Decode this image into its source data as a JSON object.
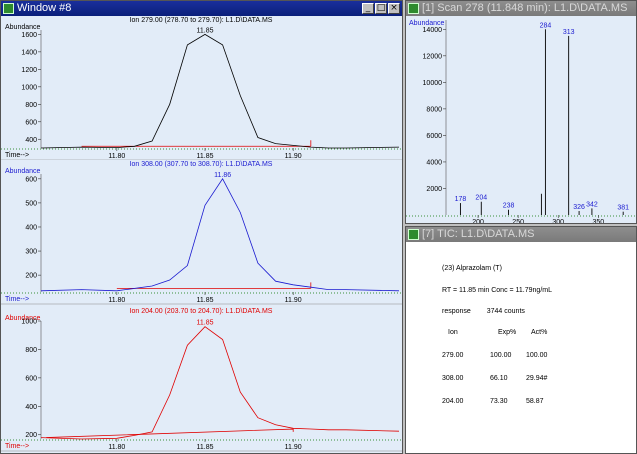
{
  "window8": {
    "title": "Window #8",
    "panels": [
      {
        "header": "Ion 279.00 (278.70 to 279.70): L1.D\\DATA.MS",
        "peak_label": "11.85",
        "y_label": "Abundance",
        "x_label": "Time-->",
        "color": "#000000",
        "chart_data": {
          "type": "line",
          "title": "Ion 279.00 (278.70 to 279.70): L1.D\\DATA.MS",
          "ylabel": "Abundance",
          "xlabel": "Time-->",
          "yticks": [
            400,
            600,
            800,
            1000,
            1200,
            1400,
            1600
          ],
          "xticks": [
            "11.80",
            "11.85",
            "11.90"
          ],
          "x": [
            11.757,
            11.78,
            11.8,
            11.81,
            11.82,
            11.83,
            11.84,
            11.85,
            11.86,
            11.87,
            11.88,
            11.89,
            11.9,
            11.91,
            11.92,
            11.93,
            11.96
          ],
          "y": [
            300,
            310,
            305,
            320,
            380,
            800,
            1480,
            1600,
            1480,
            900,
            420,
            350,
            330,
            310,
            300,
            300,
            310
          ]
        }
      },
      {
        "header": "Ion 308.00 (307.70 to 308.70): L1.D\\DATA.MS",
        "peak_label": "11.86",
        "y_label": "Abundance",
        "x_label": "Time-->",
        "color": "#1a1ad0",
        "chart_data": {
          "type": "line",
          "title": "Ion 308.00 (307.70 to 308.70): L1.D\\DATA.MS",
          "ylabel": "Abundance",
          "xlabel": "Time-->",
          "yticks": [
            200,
            300,
            400,
            500,
            600
          ],
          "xticks": [
            "11.80",
            "11.85",
            "11.90"
          ],
          "x": [
            11.757,
            11.78,
            11.8,
            11.82,
            11.83,
            11.84,
            11.85,
            11.86,
            11.87,
            11.88,
            11.89,
            11.9,
            11.91,
            11.92,
            11.93,
            11.96
          ],
          "y": [
            135,
            140,
            135,
            155,
            180,
            240,
            490,
            600,
            460,
            250,
            175,
            160,
            150,
            140,
            140,
            135
          ]
        }
      },
      {
        "header": "Ion 204.00 (203.70 to 204.70): L1.D\\DATA.MS",
        "peak_label": "11.85",
        "y_label": "Abundance",
        "x_label": "Time-->",
        "color": "#e00000",
        "chart_data": {
          "type": "line",
          "title": "Ion 204.00 (203.70 to 204.70): L1.D\\DATA.MS",
          "ylabel": "Abundance",
          "xlabel": "Time-->",
          "yticks": [
            200,
            400,
            600,
            800,
            1000
          ],
          "xticks": [
            "11.80",
            "11.85",
            "11.90"
          ],
          "x": [
            11.757,
            11.78,
            11.8,
            11.81,
            11.82,
            11.83,
            11.84,
            11.85,
            11.86,
            11.87,
            11.88,
            11.89,
            11.9,
            11.91,
            11.92,
            11.93,
            11.96
          ],
          "y": [
            180,
            170,
            175,
            195,
            220,
            480,
            830,
            960,
            870,
            500,
            320,
            270,
            245,
            240,
            235,
            235,
            225
          ]
        }
      }
    ]
  },
  "scan": {
    "title": "[1] Scan 278 (11.848 min): L1.D\\DATA.MS",
    "y_label": "Abundance",
    "chart_data": {
      "type": "bar",
      "ylabel": "Abundance",
      "yticks": [
        2000,
        4000,
        6000,
        8000,
        10000,
        12000,
        14000
      ],
      "xticks": [
        "200",
        "250",
        "300",
        "350"
      ],
      "x": [
        178,
        204,
        238,
        279,
        284,
        313,
        326,
        342,
        381
      ],
      "values": [
        900,
        1000,
        400,
        1600,
        14000,
        13500,
        300,
        500,
        250
      ],
      "labels": [
        "178",
        "204",
        "238",
        "",
        "284",
        "313",
        "326",
        "342",
        "381"
      ]
    }
  },
  "tic": {
    "title": "[7] TIC: L1.D\\DATA.MS",
    "compound": "(23)  Alprazolam (T)",
    "rt_line": "RT = 11.85 min  Conc = 11.79ng/mL",
    "response_label": "response",
    "response_value": "3744 counts",
    "headers": [
      "Ion",
      "Exp%",
      "Act%"
    ],
    "rows": [
      [
        "279.00",
        "100.00",
        "100.00"
      ],
      [
        "308.00",
        "66.10",
        "29.94#"
      ],
      [
        "204.00",
        "73.30",
        "58.87"
      ]
    ]
  }
}
